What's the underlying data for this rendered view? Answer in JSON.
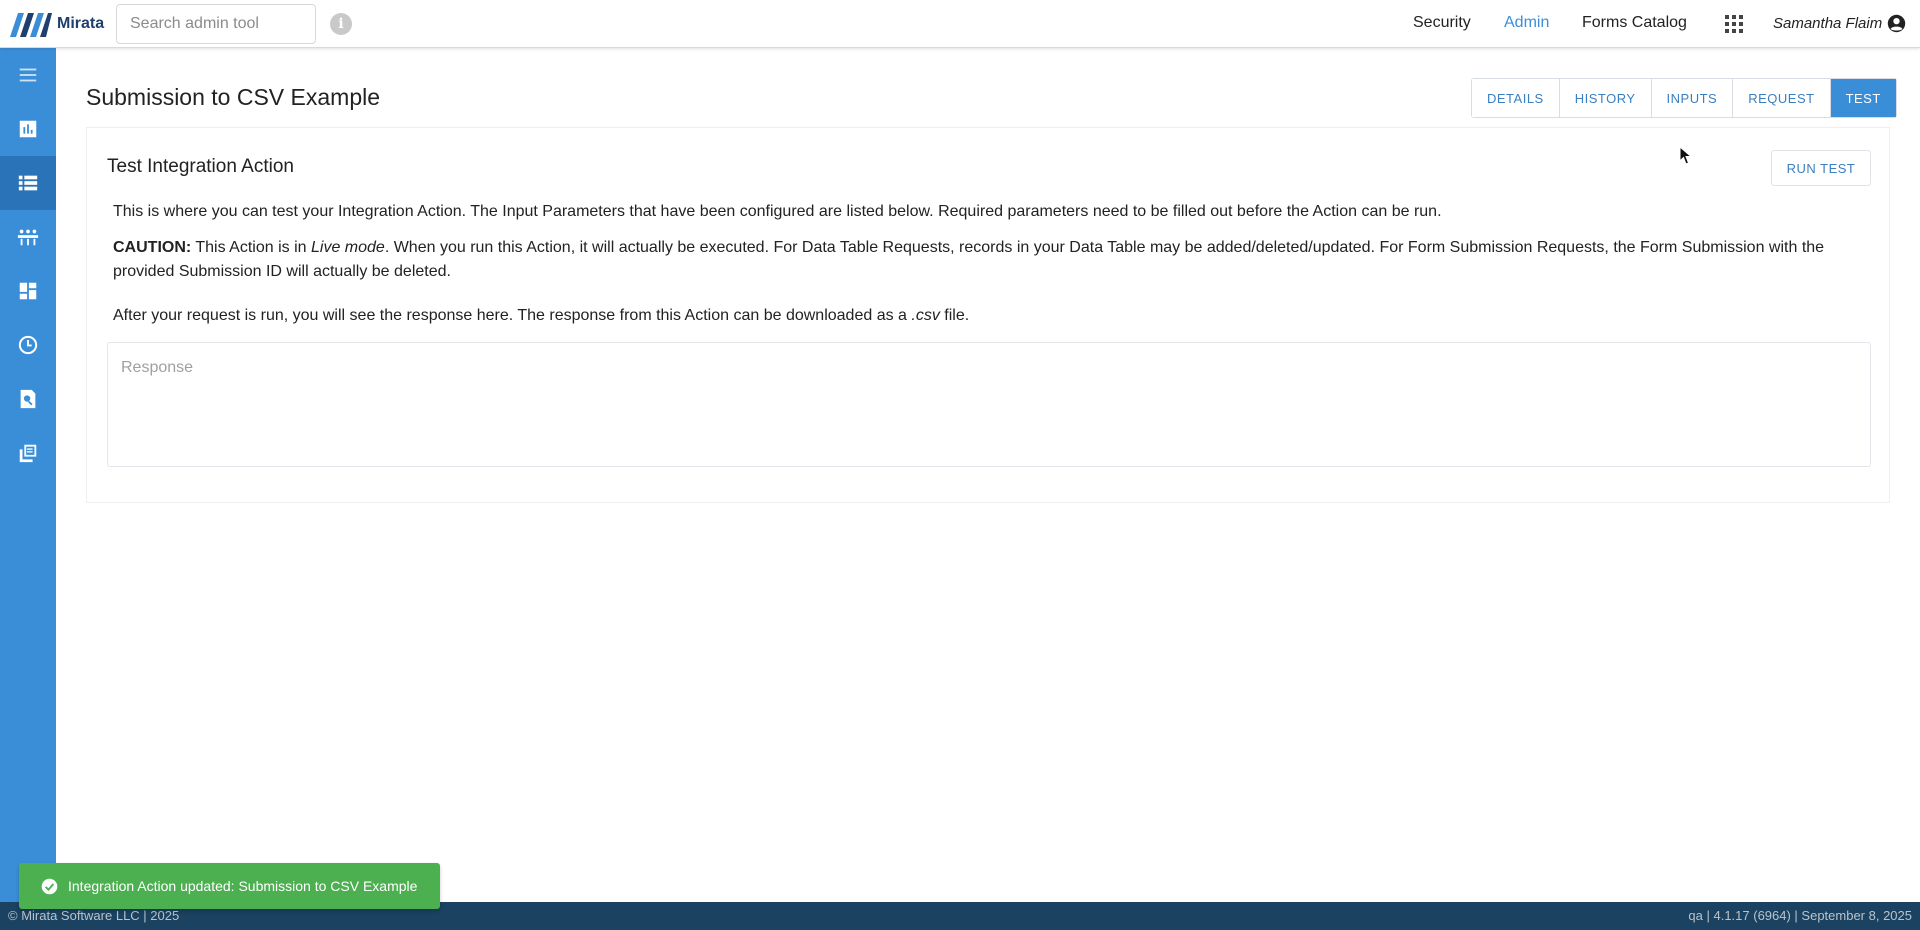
{
  "header": {
    "logo_text": "Mirata",
    "search_placeholder": "Search admin tool",
    "nav": {
      "security": "Security",
      "admin": "Admin",
      "forms_catalog": "Forms Catalog"
    },
    "user_name": "Samantha Flaim"
  },
  "sidebar": {
    "items": [
      {
        "icon": "menu-icon"
      },
      {
        "icon": "bar-chart-icon"
      },
      {
        "icon": "list-icon",
        "active": true
      },
      {
        "icon": "integration-icon"
      },
      {
        "icon": "dashboard-icon"
      },
      {
        "icon": "clock-icon"
      },
      {
        "icon": "search-document-icon"
      },
      {
        "icon": "library-icon"
      }
    ]
  },
  "page": {
    "title": "Submission to CSV Example",
    "tabs": [
      {
        "label": "DETAILS"
      },
      {
        "label": "HISTORY"
      },
      {
        "label": "INPUTS"
      },
      {
        "label": "REQUEST"
      },
      {
        "label": "TEST",
        "active": true
      }
    ]
  },
  "card": {
    "title": "Test Integration Action",
    "run_button": "RUN TEST",
    "intro": "This is where you can test your Integration Action. The Input Parameters that have been configured are listed below. Required parameters need to be filled out before the Action can be run.",
    "caution_label": "CAUTION:",
    "caution_pre": " This Action is in ",
    "caution_mode": "Live mode",
    "caution_post": ". When you run this Action, it will actually be executed. For Data Table Requests, records in your Data Table may be added/deleted/updated. For Form Submission Requests, the Form Submission with the provided Submission ID will actually be deleted.",
    "after_pre": "After your request is run, you will see the response here. The response from this Action can be downloaded as a ",
    "after_ext": ".csv",
    "after_post": " file.",
    "response_placeholder": "Response",
    "response_value": ""
  },
  "toast": {
    "message": "Integration Action updated: Submission to CSV Example"
  },
  "footer": {
    "left": "© Mirata Software LLC | 2025",
    "right": "qa | 4.1.17 (6964) | September 8, 2025"
  },
  "colors": {
    "brand_blue": "#3a8ed8",
    "sidebar_active": "#2a73b8",
    "footer_bg": "#1b4260",
    "toast_green": "#4caf50"
  }
}
